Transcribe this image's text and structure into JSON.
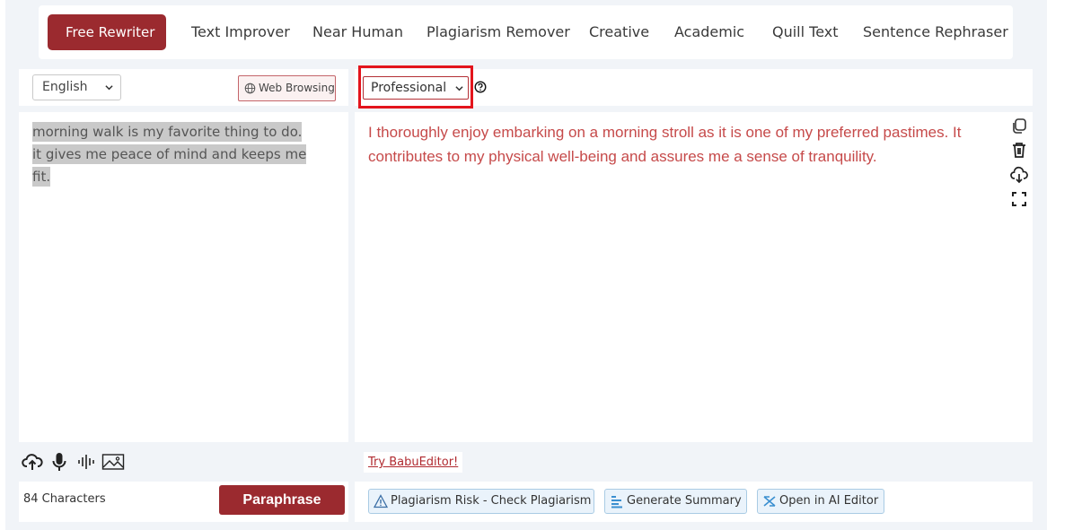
{
  "modes": [
    {
      "label": "Free Rewriter",
      "active": true
    },
    {
      "label": "Text Improver"
    },
    {
      "label": "Near Human"
    },
    {
      "label": "Plagiarism Remover"
    },
    {
      "label": "Creative"
    },
    {
      "label": "Academic"
    },
    {
      "label": "Quill Text"
    },
    {
      "label": "Sentence Rephraser"
    }
  ],
  "left": {
    "language": "English",
    "web_browsing_label": "Web Browsing",
    "input_text": "morning walk is my favorite thing to do. it gives me peace of mind and keeps me fit.",
    "char_count": "84 Characters",
    "paraphrase_label": "Paraphrase"
  },
  "right": {
    "tone": "Professional",
    "output_text": "I thoroughly enjoy embarking on a morning stroll as it is one of my preferred pastimes. It contributes to my physical well-being and assures me a sense of tranquility.",
    "try_link": "Try BabuEditor!",
    "actions": {
      "plagiarism": "Plagiarism Risk - Check Plagiarism",
      "summary": "Generate Summary",
      "ai_editor": "Open in AI Editor"
    }
  },
  "colors": {
    "brand": "#9b2a2f",
    "output_text": "#c64a4a",
    "highlight": "#e3141c",
    "action_bg": "#eaf3fb"
  },
  "icons": [
    "upload-icon",
    "microphone-icon",
    "audio-wave-icon",
    "image-icon",
    "copy-icon",
    "trash-icon",
    "download-icon",
    "fullscreen-icon",
    "globe-icon",
    "help-icon",
    "warning-icon",
    "summary-icon",
    "ai-editor-icon"
  ]
}
